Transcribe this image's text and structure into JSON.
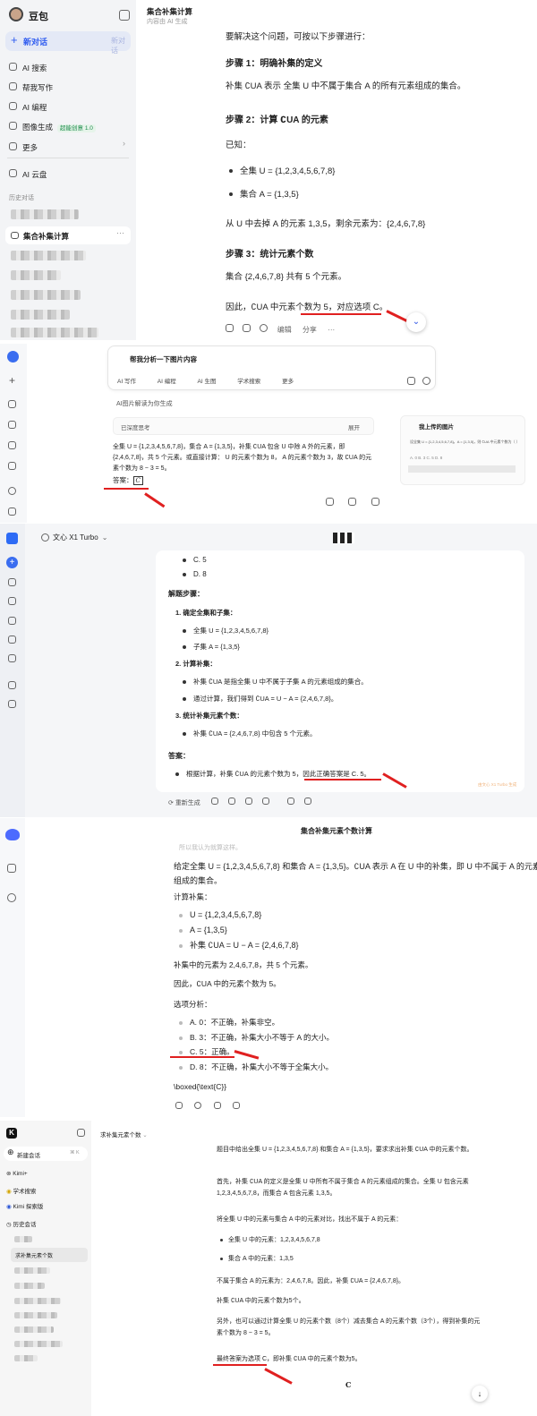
{
  "p1": {
    "brand": "豆包",
    "new_chat": "新对话",
    "new_chat_shortcut": "新对话",
    "nav": [
      "AI 搜索",
      "帮我写作",
      "AI 编程",
      "图像生成",
      "更多"
    ],
    "image_badge": "超能创意 1.0",
    "cloud": "AI 云盘",
    "history": "历史对话",
    "active_chat": "集合补集计算",
    "title": "集合补集计算",
    "subtitle": "内容由 AI 生成",
    "intro": "要解决这个问题，可按以下步骤进行：",
    "step1": "步骤 1：明确补集的定义",
    "step1_body": "补集 ∁UA 表示 全集 U 中不属于集合 A 的所有元素组成的集合。",
    "step2": "步骤 2：计算 ∁UA 的元素",
    "known": "已知：",
    "b1": "全集 U = {1,2,3,4,5,6,7,8}",
    "b2": "集合 A = {1,3,5}",
    "remove": "从 U 中去掉 A 的元素 1,3,5，剩余元素为：{2,4,6,7,8}",
    "step3": "步骤 3：统计元素个数",
    "step3_body": "集合 {2,4,6,7,8} 共有 5 个元素。",
    "concl_a": "因此，∁UA 中元素个数为 5，",
    "concl_b": "对应选项 C。",
    "actions": [
      "编辑",
      "分享"
    ]
  },
  "p2": {
    "prompt": "帮我分析一下图片内容",
    "chips": [
      "AI 写作",
      "AI 编程",
      "AI 生图",
      "学术搜索",
      "更多"
    ],
    "hint": "AI图片解读为你生成",
    "thinking": "已深度思考",
    "expand": "展开",
    "body": "全集 U = {1,2,3,4,5,6,7,8}，集合 A = {1,3,5}，补集 ∁UA 包含 U 中除 A 外的元素，即 {2,4,6,7,8}，共 5 个元素。或直接计算： U 的元素个数为 8， A 的元素个数为 3，故 ∁UA 的元素个数为 8 − 3 = 5。",
    "answer_label": "答案：",
    "answer": "C",
    "upload_title": "我上传的图片",
    "upload_text": "设全集 U = {1,2,3,4,5,6,7,8}，A = {1,3,5}，则 ∁UA 中元素个数为（ ）",
    "upload_opts": "A. 0   B. 3   C. 5   D. 8"
  },
  "p3": {
    "model": "文心 X1 Turbo",
    "opt_c": "C. 5",
    "opt_d": "D. 8",
    "steps_title": "解题步骤：",
    "s1": "确定全集和子集：",
    "s1a": "全集 U = {1,2,3,4,5,6,7,8}",
    "s1b": "子集 A = {1,3,5}",
    "s2": "计算补集：",
    "s2a": "补集 ∁UA 是指全集 U 中不属于子集 A 的元素组成的集合。",
    "s2b": "通过计算，我们得到 ∁UA = U − A = {2,4,6,7,8}。",
    "s3": "统计补集元素个数：",
    "s3a": "补集 ∁UA = {2,4,6,7,8} 中包含 5 个元素。",
    "ans_title": "答案：",
    "ans_a": "根据计算，补集 ∁UA 的元素个数为 5，",
    "ans_b": "因此正确答案是 C. 5。",
    "watermark": "由文心 X1 Turbo 生成",
    "regen": "重新生成"
  },
  "p4": {
    "title": "集合补集元素个数计算",
    "faded": "所以我认为就算这样。",
    "intro": "给定全集 U = {1,2,3,4,5,6,7,8} 和集合 A = {1,3,5}。∁UA 表示 A 在 U 中的补集，即 U 中不属于 A 的元素组成的集合。",
    "calc": "计算补集：",
    "c1": "U = {1,2,3,4,5,6,7,8}",
    "c2": "A = {1,3,5}",
    "c3": "补集 ∁UA = U − A = {2,4,6,7,8}",
    "elements": "补集中的元素为 2,4,6,7,8，共 5 个元素。",
    "therefore": "因此，∁UA 中的元素个数为 5。",
    "analysis": "选项分析：",
    "o1": "A. 0：不正确，补集非空。",
    "o2": "B. 3：不正确，补集大小不等于 A 的大小。",
    "o3": "C. 5：正确。",
    "o4": "D. 8：不正确，补集大小不等于全集大小。",
    "boxed": "\\boxed{\\text{C}}"
  },
  "p5": {
    "new_chat": "新建会话",
    "shortcut": "⌘ K",
    "nav": [
      "Kimi+",
      "学术搜索",
      "Kimi 探索版"
    ],
    "history": "历史会话",
    "active": "求补集元素个数",
    "header": "求补集元素个数",
    "l1": "题目中给出全集 U = {1,2,3,4,5,6,7,8} 和集合 A = {1,3,5}，要求求出补集 ∁UA 中的元素个数。",
    "l2": "首先，补集 ∁UA 的定义是全集 U 中所有不属于集合 A 的元素组成的集合。全集 U 包含元素 1,2,3,4,5,6,7,8，而集合 A 包含元素 1,3,5。",
    "l3": "将全集 U 中的元素与集合 A 中的元素对比，找出不属于 A 的元素：",
    "b1": "全集 U 中的元素：1,2,3,4,5,6,7,8",
    "b2": "集合 A 中的元素：1,3,5",
    "l4": "不属于集合 A 的元素为：2,4,6,7,8。因此，补集 ∁UA = {2,4,6,7,8}。",
    "l5": "补集 ∁UA 中的元素个数为5个。",
    "l6": "另外，也可以通过计算全集 U 的元素个数（8个）减去集合 A 的元素个数（3个），得到补集的元素个数为 8 − 3 = 5。",
    "final": "最终答案为选项 C，即补集 ∁UA 中的元素个数为5。",
    "boxed": "C"
  }
}
